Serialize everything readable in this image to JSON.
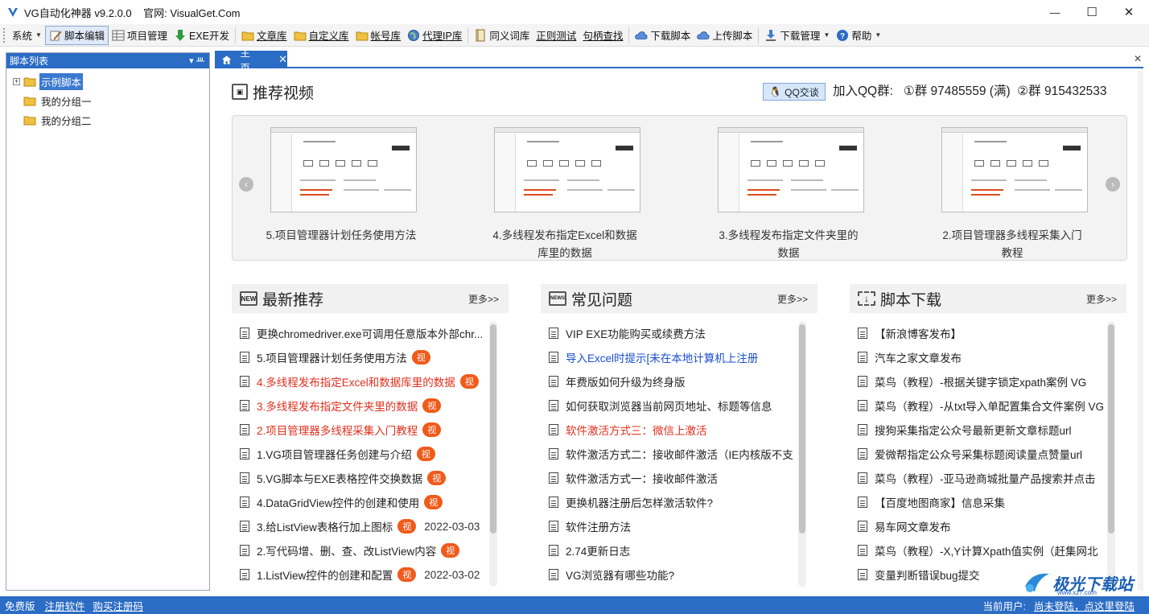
{
  "window": {
    "title": "VG自动化神器 v9.2.0.0    官网: VisualGet.Com",
    "minimize": "—",
    "maximize": "☐",
    "close": "✕"
  },
  "toolbar": {
    "items": [
      {
        "label": "系统",
        "icon": "none",
        "dropdown": true
      },
      {
        "label": "脚本编辑",
        "icon": "edit-icon",
        "active": true
      },
      {
        "label": "项目管理",
        "icon": "grid-icon"
      },
      {
        "label": "EXE开发",
        "icon": "download-arrow-icon"
      },
      {
        "label": "文章库",
        "icon": "folder-icon",
        "underline": true
      },
      {
        "label": "自定义库",
        "icon": "folder-icon",
        "underline": true
      },
      {
        "label": "帐号库",
        "icon": "folder-icon",
        "underline": true
      },
      {
        "label": "代理IP库",
        "icon": "globe-icon",
        "underline": true
      },
      {
        "label": "同义词库",
        "icon": "book-icon"
      },
      {
        "label": "正则测试",
        "icon": "none",
        "underline": true
      },
      {
        "label": "句柄查找",
        "icon": "none",
        "underline": true
      },
      {
        "label": "下载脚本",
        "icon": "cloud-icon"
      },
      {
        "label": "上传脚本",
        "icon": "cloud-icon"
      },
      {
        "label": "下载管理",
        "icon": "download-icon",
        "dropdown": true
      },
      {
        "label": "帮助",
        "icon": "help-icon",
        "dropdown": true
      }
    ]
  },
  "sidebar": {
    "title": "脚本列表",
    "pin": "▾ ᚈ",
    "tree": [
      {
        "label": "示例脚本",
        "expand": "+",
        "selected": true
      },
      {
        "label": "我的分组一",
        "expand": ""
      },
      {
        "label": "我的分组二",
        "expand": ""
      }
    ]
  },
  "tabs": {
    "active": {
      "label": "主页",
      "close": "✕"
    },
    "close_all": "✕"
  },
  "recommend": {
    "title": "推荐视频",
    "qq_button": "QQ交谈",
    "qq_text": "加入QQ群:   ①群 97485559 (满)  ②群 915432533",
    "videos": [
      {
        "caption": "5.项目管理器计划任务使用方法"
      },
      {
        "caption": "4.多线程发布指定Excel和数据库里的数据"
      },
      {
        "caption": "3.多线程发布指定文件夹里的数据"
      },
      {
        "caption": "2.项目管理器多线程采集入门教程"
      }
    ]
  },
  "panels": [
    {
      "title": "最新推荐",
      "icon_text": "NEW",
      "more": "更多>>",
      "items": [
        {
          "text": "更换chromedriver.exe可调用任意版本外部chr...",
          "color": "normal"
        },
        {
          "text": "5.项目管理器计划任务使用方法",
          "badge": "视",
          "color": "normal"
        },
        {
          "text": "4.多线程发布指定Excel和数据库里的数据",
          "badge": "视",
          "color": "red"
        },
        {
          "text": "3.多线程发布指定文件夹里的数据",
          "badge": "视",
          "color": "red"
        },
        {
          "text": "2.项目管理器多线程采集入门教程",
          "badge": "视",
          "color": "red"
        },
        {
          "text": "1.VG项目管理器任务创建与介绍",
          "badge": "视",
          "color": "normal"
        },
        {
          "text": "5.VG脚本与EXE表格控件交换数据",
          "badge": "视",
          "color": "normal"
        },
        {
          "text": "4.DataGridView控件的创建和使用",
          "badge": "视",
          "color": "normal"
        },
        {
          "text": "3.给ListView表格行加上图标",
          "badge": "视",
          "date": "2022-03-03",
          "color": "normal"
        },
        {
          "text": "2.写代码增、删、查、改ListView内容",
          "badge": "视",
          "color": "normal"
        },
        {
          "text": "1.ListView控件的创建和配置",
          "badge": "视",
          "date": "2022-03-02",
          "color": "normal"
        }
      ]
    },
    {
      "title": "常见问题",
      "icon_text": "NEWS",
      "more": "更多>>",
      "items": [
        {
          "text": "VIP EXE功能购买或续费方法",
          "color": "normal"
        },
        {
          "text": "导入Excel时提示[未在本地计算机上注册",
          "color": "blue"
        },
        {
          "text": "年费版如何升级为终身版",
          "color": "normal"
        },
        {
          "text": "如何获取浏览器当前网页地址、标题等信息",
          "color": "normal"
        },
        {
          "text": "软件激活方式三：微信上激活",
          "color": "red"
        },
        {
          "text": "软件激活方式二：接收邮件激活（IE内核版不支",
          "color": "normal"
        },
        {
          "text": "软件激活方式一：接收邮件激活",
          "color": "normal"
        },
        {
          "text": "更换机器注册后怎样激活软件?",
          "color": "normal"
        },
        {
          "text": "软件注册方法",
          "color": "normal"
        },
        {
          "text": "2.74更新日志",
          "color": "normal"
        },
        {
          "text": "VG浏览器有哪些功能?",
          "color": "normal"
        }
      ]
    },
    {
      "title": "脚本下载",
      "icon_text": "↓",
      "more": "更多>>",
      "items": [
        {
          "text": "【新浪博客发布】",
          "color": "normal"
        },
        {
          "text": "汽车之家文章发布",
          "color": "normal"
        },
        {
          "text": "菜鸟（教程）-根据关键字锁定xpath案例 VG",
          "color": "normal"
        },
        {
          "text": "菜鸟（教程）-从txt导入单配置集合文件案例 VG",
          "color": "normal"
        },
        {
          "text": "搜狗采集指定公众号最新更新文章标题url",
          "color": "normal"
        },
        {
          "text": "爱微帮指定公众号采集标题阅读量点赞量url",
          "color": "normal"
        },
        {
          "text": "菜鸟（教程）-亚马逊商城批量产品搜索并点击",
          "color": "normal"
        },
        {
          "text": "【百度地图商家】信息采集",
          "color": "normal"
        },
        {
          "text": "易车网文章发布",
          "color": "normal"
        },
        {
          "text": "菜鸟（教程）-X,Y计算Xpath值实例（赶集网北",
          "color": "normal"
        },
        {
          "text": "变量判断错误bug提交",
          "color": "normal"
        }
      ]
    }
  ],
  "statusbar": {
    "edition": "免费版",
    "register": "注册软件",
    "buy": "购买注册码",
    "current_user_label": "当前用户:",
    "login_prompt": "尚未登陆，点这里登陆"
  },
  "watermark": {
    "text": "极光下载站",
    "sub": "www.xz7.com"
  },
  "colors": {
    "accent": "#2b6cc4",
    "badge": "#f05a1a",
    "red_text": "#e0301e",
    "blue_text": "#1a4fd0"
  }
}
